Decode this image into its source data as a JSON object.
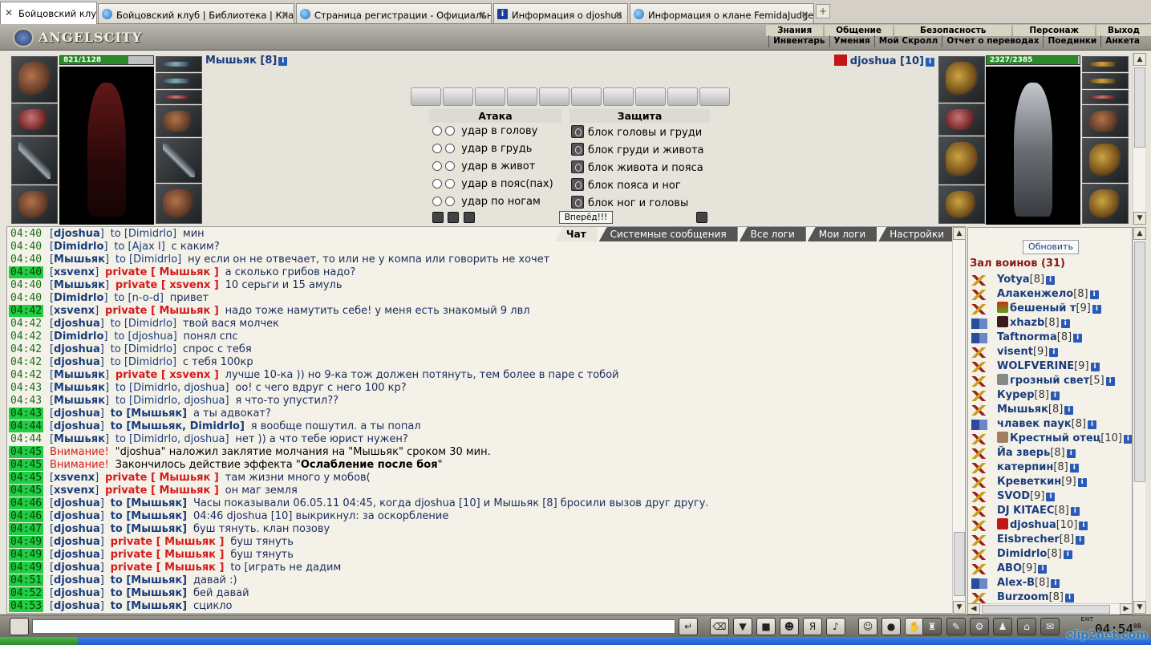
{
  "browser": {
    "tabs": [
      {
        "label": "Бойцовский клуб",
        "active": true
      },
      {
        "label": "Бойцовский клуб | Библиотека | Кла...",
        "active": false
      },
      {
        "label": "Страница регистрации - Официальн...",
        "active": false
      },
      {
        "label": "Информация о djoshua",
        "active": false
      },
      {
        "label": "Информация о клане FemidaJudges",
        "active": false
      }
    ]
  },
  "header": {
    "logo": "ANGELSCITY",
    "menu_top": [
      "Знания",
      "Общение",
      "Безопасность",
      "Персонаж",
      "Выход"
    ],
    "menu_bottom": [
      "Инвентарь",
      "Умения",
      "Мой Скролл",
      "Отчет о переводах",
      "Поединки",
      "Анкета"
    ]
  },
  "player_left": {
    "name": "Мышьяк [8]",
    "hp": "821/1128",
    "hp_fraction": 0.73
  },
  "player_right": {
    "name": "djoshua [10]",
    "hp": "2327/2385",
    "hp_fraction": 0.98
  },
  "combat": {
    "attack_header": "Атака",
    "defense_header": "Защита",
    "attacks": [
      "удар в голову",
      "удар в грудь",
      "удар в живот",
      "удар в пояс(пах)",
      "удар по ногам"
    ],
    "defenses": [
      "блок головы и груди",
      "блок груди и живота",
      "блок живота и пояса",
      "блок пояса и ног",
      "блок ног и головы"
    ],
    "forward_button": "Вперёд!!!"
  },
  "chat_tabs": [
    "Чат",
    "Системные сообщения",
    "Все логи",
    "Мои логи",
    "Настройки"
  ],
  "chat": [
    {
      "time": "04:40",
      "hl": false,
      "nick": "djoshua",
      "kind": "to",
      "to": "Dimidrlo",
      "msg": "мин"
    },
    {
      "time": "04:40",
      "hl": false,
      "nick": "Dimidrlo",
      "kind": "to",
      "to": "Ajax I",
      "msg": "с каким?"
    },
    {
      "time": "04:40",
      "hl": false,
      "nick": "Мышьяк",
      "kind": "to",
      "to": "Dimidrlo",
      "msg": "ну если он не отвечает, то или не у компа или говорить не хочет"
    },
    {
      "time": "04:40",
      "hl": true,
      "nick": "xsvenx",
      "kind": "private",
      "to": "Мышьяк",
      "msg": "а сколько грибов надо?"
    },
    {
      "time": "04:40",
      "hl": false,
      "nick": "Мышьяк",
      "kind": "private",
      "to": "xsvenx",
      "msg": "10 серьги и 15 амуль"
    },
    {
      "time": "04:40",
      "hl": false,
      "nick": "Dimidrlo",
      "kind": "to",
      "to": "n-o-d",
      "msg": "привет"
    },
    {
      "time": "04:42",
      "hl": true,
      "nick": "xsvenx",
      "kind": "private",
      "to": "Мышьяк",
      "msg": "надо тоже намутить себе! у меня есть знакомый 9 лвл"
    },
    {
      "time": "04:42",
      "hl": false,
      "nick": "djoshua",
      "kind": "to",
      "to": "Dimidrlo",
      "msg": "твой вася молчек"
    },
    {
      "time": "04:42",
      "hl": false,
      "nick": "Dimidrlo",
      "kind": "to",
      "to": "djoshua",
      "msg": "понял спс"
    },
    {
      "time": "04:42",
      "hl": false,
      "nick": "djoshua",
      "kind": "to",
      "to": "Dimidrlo",
      "msg": "спрос с тебя"
    },
    {
      "time": "04:42",
      "hl": false,
      "nick": "djoshua",
      "kind": "to",
      "to": "Dimidrlo",
      "msg": "с тебя 100кр"
    },
    {
      "time": "04:42",
      "hl": false,
      "nick": "Мышьяк",
      "kind": "private",
      "to": "xsvenx",
      "msg": "лучше 10-ка )) но 9-ка тож должен потянуть, тем более в паре с тобой"
    },
    {
      "time": "04:43",
      "hl": false,
      "nick": "Мышьяк",
      "kind": "to",
      "to": "Dimidrlo, djoshua",
      "msg": "оо! с чего вдруг с него 100 кр?"
    },
    {
      "time": "04:43",
      "hl": false,
      "nick": "Мышьяк",
      "kind": "to",
      "to": "Dimidrlo, djoshua",
      "msg": "я что-то упустил??"
    },
    {
      "time": "04:43",
      "hl": true,
      "nick": "djoshua",
      "kind": "tobold",
      "to": "Мышьяк",
      "msg": "а ты адвокат?"
    },
    {
      "time": "04:44",
      "hl": true,
      "nick": "djoshua",
      "kind": "tobold",
      "to": "Мышьяк, Dimidrlo",
      "msg": "я вообще пошутил. а ты попал"
    },
    {
      "time": "04:44",
      "hl": false,
      "nick": "Мышьяк",
      "kind": "to",
      "to": "Dimidrlo, djoshua",
      "msg": "нет )) а что тебе юрист нужен?"
    },
    {
      "time": "04:45",
      "hl": true,
      "kind": "warn",
      "label": "Внимание!",
      "msg": "\"djoshua\" наложил заклятие молчания на \"Мышьяк\" сроком 30 мин."
    },
    {
      "time": "04:45",
      "hl": true,
      "kind": "warn2",
      "label": "Внимание!",
      "msg": "Закончилось действие эффекта ",
      "bold": "Ослабление после боя"
    },
    {
      "time": "04:45",
      "hl": true,
      "nick": "xsvenx",
      "kind": "private",
      "to": "Мышьяк",
      "msg": "там жизни много у мобов("
    },
    {
      "time": "04:45",
      "hl": true,
      "nick": "xsvenx",
      "kind": "private",
      "to": "Мышьяк",
      "msg": "он маг земля"
    },
    {
      "time": "04:46",
      "hl": true,
      "nick": "djoshua",
      "kind": "tobold",
      "to": "Мышьяк",
      "msg": "Часы показывали 06.05.11 04:45, когда djoshua [10] и Мышьяк [8] бросили вызов друг другу."
    },
    {
      "time": "04:46",
      "hl": true,
      "nick": "djoshua",
      "kind": "tobold",
      "to": "Мышьяк",
      "msg": "04:46 djoshua [10] выкрикнул: за оскорбление"
    },
    {
      "time": "04:47",
      "hl": true,
      "nick": "djoshua",
      "kind": "tobold",
      "to": "Мышьяк",
      "msg": "буш тянуть. клан позову"
    },
    {
      "time": "04:49",
      "hl": true,
      "nick": "djoshua",
      "kind": "private",
      "to": "Мышьяк",
      "msg": "буш тянуть"
    },
    {
      "time": "04:49",
      "hl": true,
      "nick": "djoshua",
      "kind": "private",
      "to": "Мышьяк",
      "msg": "буш тянуть"
    },
    {
      "time": "04:49",
      "hl": true,
      "nick": "djoshua",
      "kind": "private",
      "to": "Мышьяк",
      "msg": "to [играть не дадим"
    },
    {
      "time": "04:51",
      "hl": true,
      "nick": "djoshua",
      "kind": "tobold",
      "to": "Мышьяк",
      "msg": "давай :)"
    },
    {
      "time": "04:52",
      "hl": true,
      "nick": "djoshua",
      "kind": "tobold",
      "to": "Мышьяк",
      "msg": "бей давай"
    },
    {
      "time": "04:53",
      "hl": true,
      "nick": "djoshua",
      "kind": "tobold",
      "to": "Мышьяк",
      "msg": "сцикло"
    }
  ],
  "hall": {
    "refresh": "Обновить",
    "title": "Зал воинов (31)",
    "warriors": [
      {
        "name": "Yotya",
        "lvl": "[8]",
        "icon": "sw",
        "emblem": ""
      },
      {
        "name": "Алакенжело",
        "lvl": "[8]",
        "icon": "sw",
        "emblem": ""
      },
      {
        "name": "бешеный т",
        "lvl": "[9]",
        "icon": "sw",
        "emblem": "clan"
      },
      {
        "name": "xhazb",
        "lvl": "[8]",
        "icon": "b",
        "emblem": "shield"
      },
      {
        "name": "Taftnorma",
        "lvl": "[8]",
        "icon": "b",
        "emblem": ""
      },
      {
        "name": "visent",
        "lvl": "[9]",
        "icon": "sw",
        "emblem": ""
      },
      {
        "name": "WOLFVERINE",
        "lvl": "[9]",
        "icon": "sw",
        "emblem": ""
      },
      {
        "name": "грозный свет",
        "lvl": "[5]",
        "icon": "sw",
        "emblem": "skull"
      },
      {
        "name": "Курер",
        "lvl": "[8]",
        "icon": "sw",
        "emblem": ""
      },
      {
        "name": "Мышьяк",
        "lvl": "[8]",
        "icon": "sw",
        "emblem": ""
      },
      {
        "name": "члавек паук",
        "lvl": "[8]",
        "icon": "b",
        "emblem": ""
      },
      {
        "name": "Крестный отец",
        "lvl": "[10]",
        "icon": "sw",
        "emblem": "face"
      },
      {
        "name": "Йа зверь",
        "lvl": "[8]",
        "icon": "sw",
        "emblem": ""
      },
      {
        "name": "катерпин",
        "lvl": "[8]",
        "icon": "sw",
        "emblem": ""
      },
      {
        "name": "Креветкин",
        "lvl": "[9]",
        "icon": "sw",
        "emblem": ""
      },
      {
        "name": "SVOD",
        "lvl": "[9]",
        "icon": "sw",
        "emblem": ""
      },
      {
        "name": "DJ KITAEC",
        "lvl": "[8]",
        "icon": "sw",
        "emblem": ""
      },
      {
        "name": "djoshua",
        "lvl": "[10]",
        "icon": "sw",
        "emblem": "judge"
      },
      {
        "name": "Eisbrecher",
        "lvl": "[8]",
        "icon": "sw",
        "emblem": ""
      },
      {
        "name": "Dimidrlo",
        "lvl": "[8]",
        "icon": "sw",
        "emblem": ""
      },
      {
        "name": "ABO",
        "lvl": "[9]",
        "icon": "sw",
        "emblem": ""
      },
      {
        "name": "Alex-B",
        "lvl": "[8]",
        "icon": "b",
        "emblem": ""
      },
      {
        "name": "Burzoom",
        "lvl": "[8]",
        "icon": "sw",
        "emblem": ""
      }
    ]
  },
  "clock": {
    "time": "04:54",
    "sec": "08"
  },
  "watermark": "clip2net.com"
}
